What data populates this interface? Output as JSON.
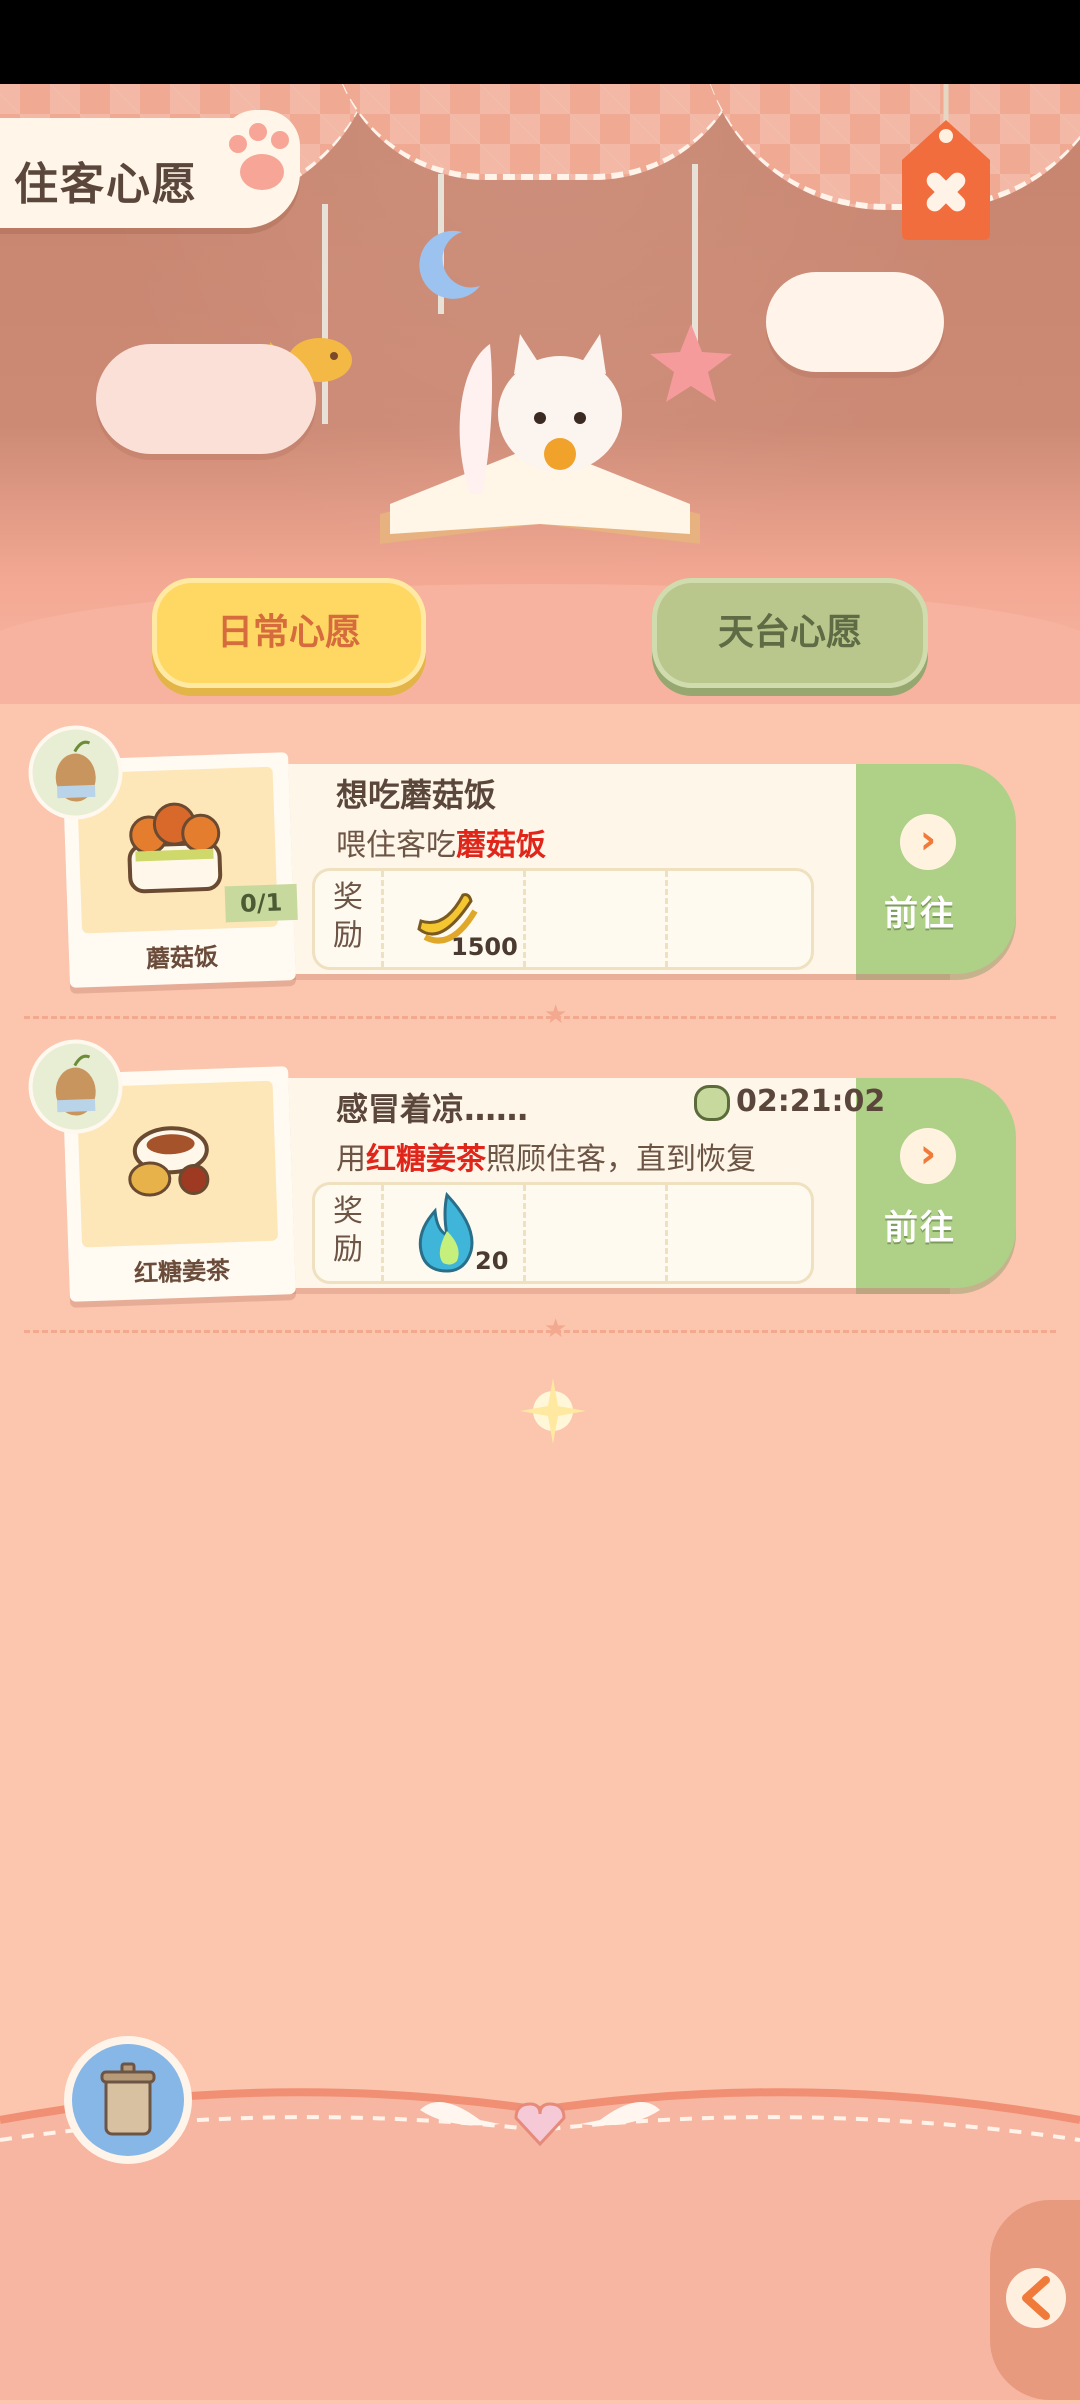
{
  "header": {
    "title": "住客心愿",
    "close_icon": "close-x-icon",
    "tabs": [
      {
        "label": "日常心愿",
        "active": true
      },
      {
        "label": "天台心愿",
        "active": false
      }
    ]
  },
  "wishes": [
    {
      "item_name": "蘑菇饭",
      "progress": "0/1",
      "title": "想吃蘑菇饭",
      "desc_prefix": "喂住客吃",
      "desc_highlight": "蘑菇饭",
      "desc_suffix": "",
      "reward_label": "奖励",
      "reward_icon": "banana-icon",
      "reward_count": "1500",
      "go_label": "前往"
    },
    {
      "item_name": "红糖姜茶",
      "title": "感冒着凉……",
      "timer": "02:21:02",
      "desc_prefix": "用",
      "desc_highlight": "红糖姜茶",
      "desc_suffix": "照顾住客，直到恢复",
      "reward_label": "奖励",
      "reward_icon": "blue-flame-icon",
      "reward_count": "20",
      "go_label": "前往"
    }
  ],
  "colors": {
    "highlight": "#e0261b",
    "go_button": "#aed087",
    "tab_active": "#ffd763",
    "tab_inactive": "#b9c78c",
    "background": "#fbc5ae"
  }
}
